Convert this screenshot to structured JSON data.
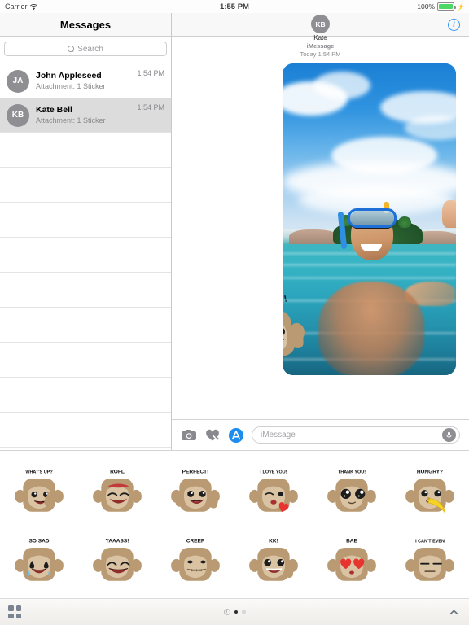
{
  "status_bar": {
    "carrier": "Carrier",
    "wifi_icon": "wifi-icon",
    "time": "1:55 PM",
    "battery_percent": "100%",
    "battery_icon": "battery-full-icon",
    "charging_icon": "lightning-bolt-icon"
  },
  "sidebar": {
    "title": "Messages",
    "search": {
      "placeholder": "Search",
      "value": "",
      "icon": "search-icon"
    },
    "conversations": [
      {
        "initials": "JA",
        "name": "John Appleseed",
        "subtitle": "Attachment: 1 Sticker",
        "time": "1:54 PM",
        "selected": false
      },
      {
        "initials": "KB",
        "name": "Kate Bell",
        "subtitle": "Attachment: 1 Sticker",
        "time": "1:54 PM",
        "selected": true
      }
    ],
    "empty_row_count": 9
  },
  "chat": {
    "contact_initials": "KB",
    "contact_name": "Kate",
    "info_button_label": "i",
    "message": {
      "service": "iMessage",
      "datetime": "Today 1:54 PM",
      "attachment_type": "photo",
      "photo_description": "man snorkeling in turquoise sea with tropical island",
      "overlay_sticker": "PERFECT!"
    },
    "toolbar": {
      "camera_icon": "camera-icon",
      "digital_touch_icon": "digital-touch-heart-icon",
      "appstore_icon": "app-store-icon",
      "input_placeholder": "iMessage",
      "input_value": "",
      "mic_icon": "microphone-icon"
    }
  },
  "sticker_drawer": {
    "stickers": [
      {
        "label": "WHAT'S UP?",
        "pose": "waving"
      },
      {
        "label": "ROFL",
        "pose": "laughing-rolling"
      },
      {
        "label": "PERFECT!",
        "pose": "thumbs-up-double"
      },
      {
        "label": "I LOVE YOU!",
        "pose": "kiss-heart"
      },
      {
        "label": "THANK YOU!",
        "pose": "big-eyes"
      },
      {
        "label": "HUNGRY?",
        "pose": "banana"
      },
      {
        "label": "SO SAD",
        "pose": "crying"
      },
      {
        "label": "YAAASS!",
        "pose": "happy-closed-eyes"
      },
      {
        "label": "CREEP",
        "pose": "creepy-smirk"
      },
      {
        "label": "KK!",
        "pose": "thumbs-up-single"
      },
      {
        "label": "BAE",
        "pose": "heart-eyes"
      },
      {
        "label": "I CAN'T EVEN",
        "pose": "flat-face"
      }
    ],
    "bottom_bar": {
      "apps_grid_icon": "apps-grid-icon",
      "recents_icon": "recents-clock-icon",
      "page_count": 2,
      "active_page": 1,
      "expand_icon": "chevron-up-icon"
    }
  },
  "colors": {
    "accent_blue": "#3595f5",
    "selected_row": "#dcdcdd",
    "avatar_gray": "#8e8e93",
    "battery_green": "#4cd863",
    "monkey_fur": "#b99a72",
    "monkey_face": "#d9c3a3"
  }
}
